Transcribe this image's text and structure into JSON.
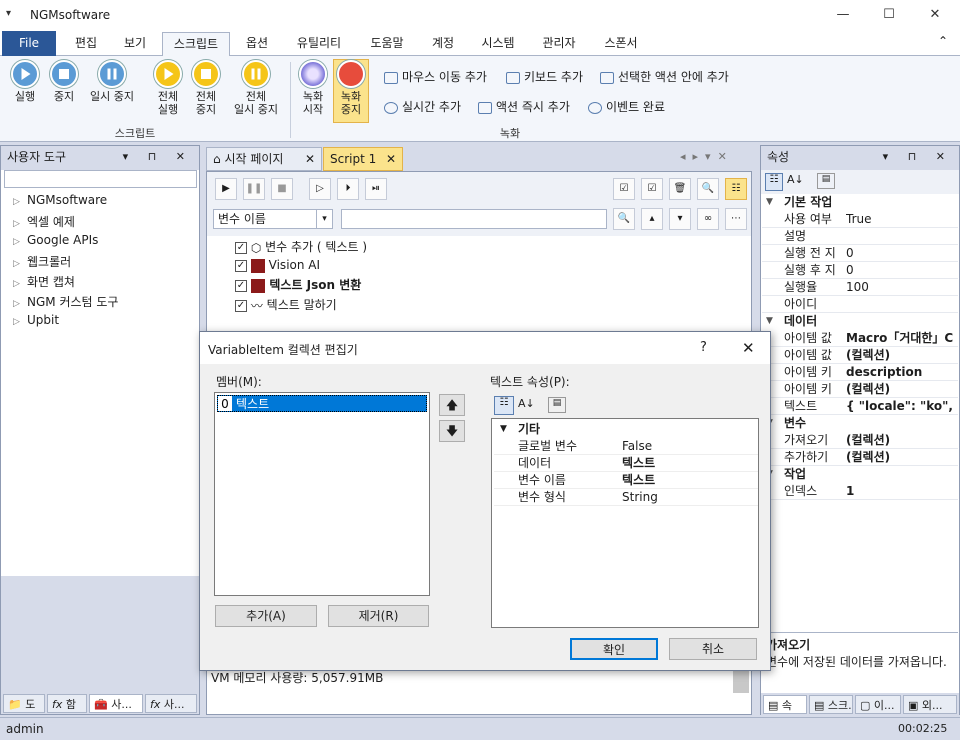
{
  "window": {
    "title": "NGMsoftware",
    "sys_glyph": "▾",
    "min": "—",
    "max": "☐",
    "close": "✕"
  },
  "ribbon_tabs": [
    "File",
    "편집",
    "보기",
    "스크립트",
    "옵션",
    "유틸리티",
    "도움말",
    "계정",
    "시스템",
    "관리자",
    "스폰서"
  ],
  "ribbon_collapse": "⌃",
  "script_group": {
    "label": "스크립트",
    "buttons": [
      {
        "line1": "실행",
        "line2": ""
      },
      {
        "line1": "중지",
        "line2": ""
      },
      {
        "line1": "일시 중지",
        "line2": ""
      },
      {
        "line1": "전체",
        "line2": "실행"
      },
      {
        "line1": "전체",
        "line2": "중지"
      },
      {
        "line1": "전체",
        "line2": "일시 중지"
      }
    ]
  },
  "record_group": {
    "label": "녹화",
    "buttons": [
      {
        "line1": "녹화",
        "line2": "시작"
      },
      {
        "line1": "녹화",
        "line2": "중지"
      }
    ],
    "small": [
      "마우스 이동 추가",
      "키보드 추가",
      "선택한 액션 안에 추가",
      "실시간 추가",
      "액션 즉시 추가",
      "이벤트 완료"
    ]
  },
  "left_panel": {
    "title": "사용자 도구",
    "items": [
      "NGMsoftware",
      "엑셀 예제",
      "Google APIs",
      "웹크롤러",
      "화면 캡쳐",
      "NGM 커스텀 도구",
      "Upbit"
    ],
    "bottom_tabs": [
      "도",
      "함",
      "사...",
      "사..."
    ]
  },
  "doc_tabs": [
    {
      "label": "시작 페이지"
    },
    {
      "label": "Script 1"
    }
  ],
  "var_select": "변수 이름",
  "actions": [
    {
      "label": "변수 추가 ( 텍스트 )",
      "bold": false
    },
    {
      "label": "Vision AI",
      "bold": false
    },
    {
      "label": "텍스트 Json 변환",
      "bold": true
    },
    {
      "label": "텍스트 말하기",
      "bold": false
    }
  ],
  "vm_memory": "VM 메모리 사용량: 5,057.91MB",
  "properties": {
    "title": "속성",
    "categories": [
      {
        "name": "기본 작업",
        "rows": [
          [
            "사용 여부",
            "True",
            false
          ],
          [
            "설명",
            "",
            false
          ],
          [
            "실행 전 지",
            "0",
            false
          ],
          [
            "실행 후 지",
            "0",
            false
          ],
          [
            "실행율",
            "100",
            false
          ],
          [
            "아이디",
            "",
            false
          ]
        ]
      },
      {
        "name": "데이터",
        "rows": [
          [
            "아이템 값",
            "Macro「거대한」C",
            true
          ],
          [
            "아이템 값",
            "(컬렉션)",
            true
          ],
          [
            "아이템 키",
            "description",
            true
          ],
          [
            "아이템 키",
            "(컬렉션)",
            true
          ],
          [
            "텍스트",
            "{ \"locale\": \"ko\", \"",
            true
          ]
        ]
      },
      {
        "name": "변수",
        "rows": [
          [
            "가져오기",
            "(컬렉션)",
            true
          ],
          [
            "추가하기",
            "(컬렉션)",
            true
          ]
        ]
      },
      {
        "name": "작업",
        "rows": [
          [
            "인덱스",
            "1",
            true
          ]
        ]
      }
    ],
    "desc_title": "가져오기",
    "desc_text": "변수에 저장된 데이터를 가져옵니다.",
    "bottom_tabs": [
      "속",
      "스크...",
      "이...",
      "외..."
    ]
  },
  "dialog": {
    "title": "VariableItem 컬렉션 편집기",
    "help": "?",
    "members_label": "멤버(M):",
    "member_index": "0",
    "member_text": "텍스트",
    "props_label": "텍스트 속성(P):",
    "category": "기타",
    "rows": [
      [
        "글로벌 변수",
        "False",
        false
      ],
      [
        "데이터",
        "텍스트",
        true
      ],
      [
        "변수 이름",
        "텍스트",
        true
      ],
      [
        "변수 형식",
        "String",
        false
      ]
    ],
    "add": "추가(A)",
    "remove": "제거(R)",
    "ok": "확인",
    "cancel": "취소"
  },
  "status": {
    "user": "admin",
    "time": "00:02:25"
  }
}
